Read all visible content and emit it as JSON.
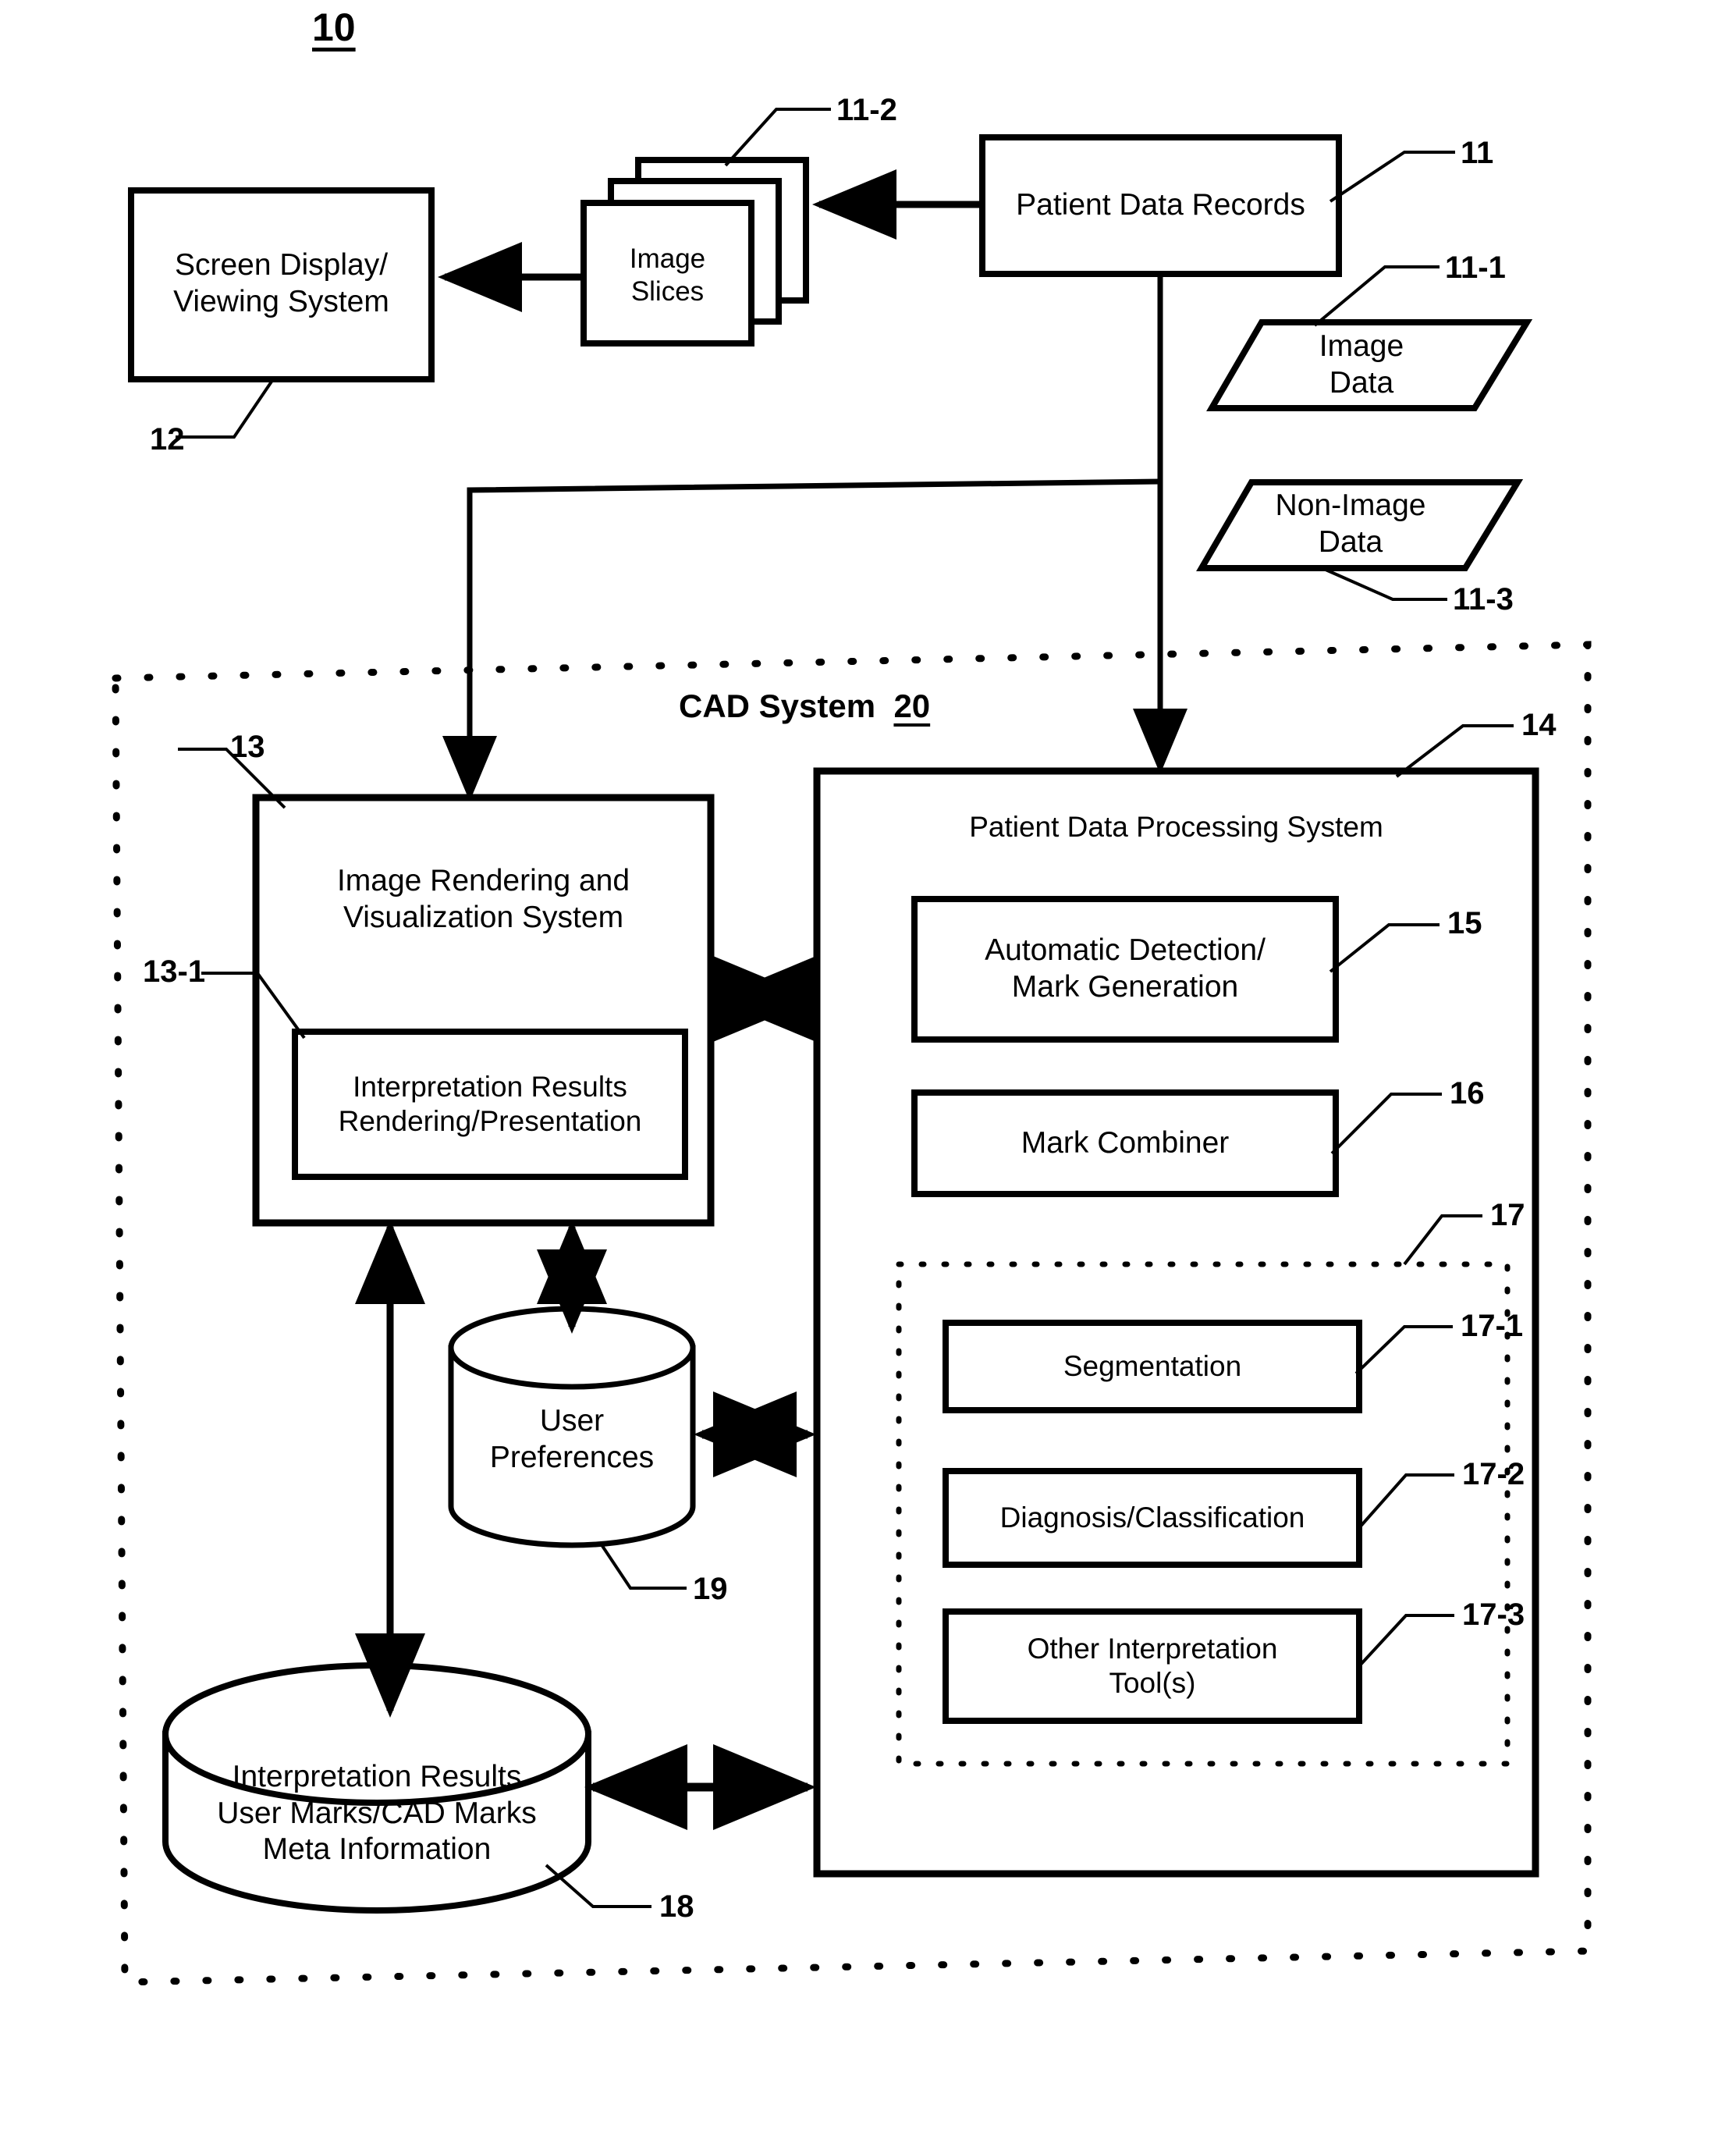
{
  "figure": {
    "number": "10",
    "cad_system_title": "CAD System",
    "cad_system_ref": "20"
  },
  "nodes": {
    "screen_display": {
      "label_line1": "Screen Display/",
      "label_line2": "Viewing System",
      "ref": "12"
    },
    "image_slices": {
      "label_line1": "Image",
      "label_line2": "Slices",
      "ref": "11-2"
    },
    "patient_data_records": {
      "label": "Patient Data Records",
      "ref": "11"
    },
    "image_data": {
      "label_line1": "Image",
      "label_line2": "Data",
      "ref": "11-1"
    },
    "non_image_data": {
      "label_line1": "Non-Image",
      "label_line2": "Data",
      "ref": "11-3"
    },
    "image_rendering": {
      "label_line1": "Image Rendering and",
      "label_line2": "Visualization System",
      "ref": "13"
    },
    "interpretation_rendering": {
      "label_line1": "Interpretation Results",
      "label_line2": "Rendering/Presentation",
      "ref": "13-1"
    },
    "patient_data_processing": {
      "label": "Patient Data Processing System",
      "ref": "14"
    },
    "automatic_detection": {
      "label_line1": "Automatic Detection/",
      "label_line2": "Mark Generation",
      "ref": "15"
    },
    "mark_combiner": {
      "label": "Mark Combiner",
      "ref": "16"
    },
    "interpretation_tools_group": {
      "ref": "17"
    },
    "segmentation": {
      "label": "Segmentation",
      "ref": "17-1"
    },
    "diagnosis_classification": {
      "label": "Diagnosis/Classification",
      "ref": "17-2"
    },
    "other_interpretation_tools": {
      "label_line1": "Other Interpretation",
      "label_line2": "Tool(s)",
      "ref": "17-3"
    },
    "user_preferences": {
      "label_line1": "User",
      "label_line2": "Preferences",
      "ref": "19"
    },
    "interpretation_results_store": {
      "label_line1": "Interpretation Results",
      "label_line2": "User Marks/CAD Marks",
      "label_line3": "Meta Information",
      "ref": "18"
    }
  },
  "colors": {
    "ink": "#000000",
    "paper": "#ffffff"
  }
}
